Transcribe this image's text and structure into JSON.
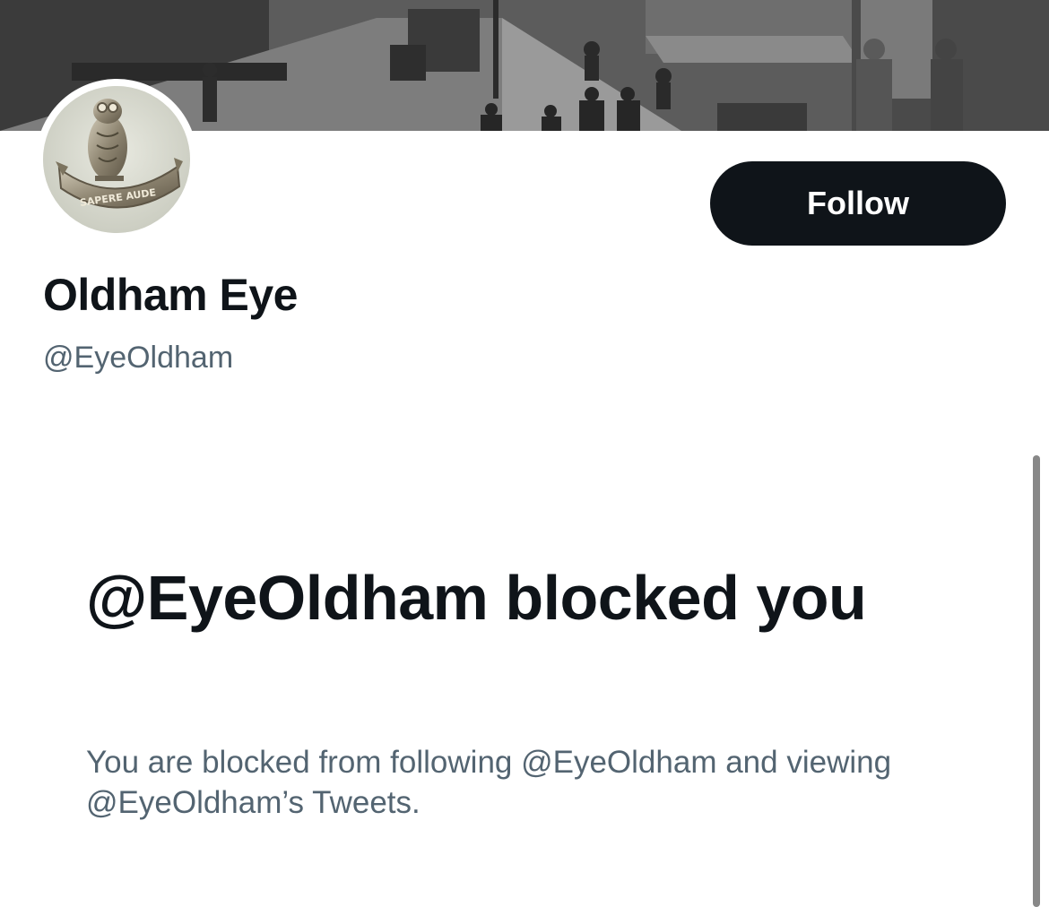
{
  "profile": {
    "display_name": "Oldham Eye",
    "handle": "@EyeOldham",
    "avatar_icon": "owl-badge-icon",
    "badge_motto": "SAPERE AUDE"
  },
  "actions": {
    "follow_label": "Follow"
  },
  "blocked": {
    "title": "@EyeOldham blocked you",
    "message": "You are blocked from following @EyeOldham and viewing @EyeOldham’s Tweets."
  },
  "colors": {
    "primary_text": "#0f1419",
    "secondary_text": "#536471",
    "button_bg": "#0f1419",
    "button_text": "#ffffff"
  }
}
